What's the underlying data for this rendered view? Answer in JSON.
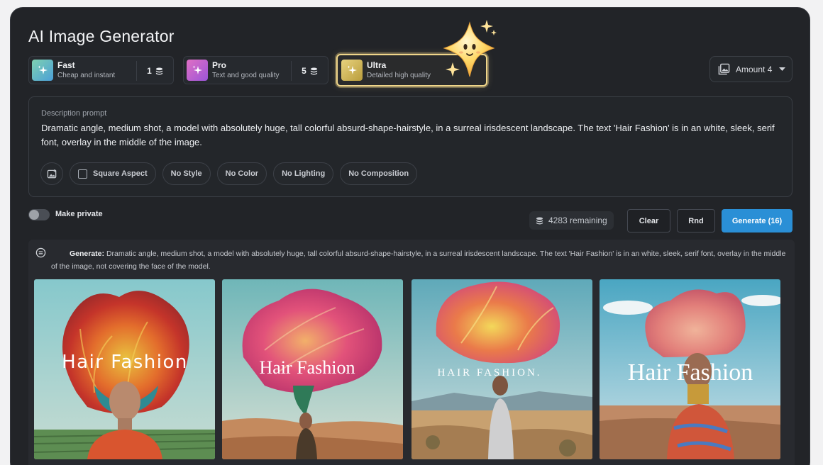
{
  "app": {
    "title": "AI Image Generator"
  },
  "tiers": [
    {
      "name": "Fast",
      "sub": "Cheap and instant",
      "cost": "1"
    },
    {
      "name": "Pro",
      "sub": "Text and good quality",
      "cost": "5"
    },
    {
      "name": "Ultra",
      "sub": "Detailed high quality",
      "selected": true
    }
  ],
  "amount": {
    "label": "Amount 4"
  },
  "prompt": {
    "label": "Description prompt",
    "text": "Dramatic angle, medium shot, a model with absolutely huge, tall colorful absurd-shape-hairstyle, in a surreal irisdescent landscape. The text 'Hair Fashion' is in an white, sleek, serif font, overlay in the middle of the image."
  },
  "chips": {
    "square": "Square Aspect",
    "style": "No Style",
    "color": "No Color",
    "lighting": "No Lighting",
    "composition": "No Composition"
  },
  "private": {
    "label": "Make private",
    "on": false
  },
  "credits": {
    "remaining": "4283 remaining"
  },
  "actions": {
    "clear": "Clear",
    "rnd": "Rnd",
    "generate": "Generate (16)"
  },
  "result": {
    "prefix": "Generate:",
    "text": "Dramatic angle, medium shot, a model with absolutely huge, tall colorful absurd-shape-hairstyle, in a surreal irisdescent landscape. The text 'Hair Fashion' is in an white, sleek, serif font, overlay in the middle of the image, not covering the face of the model."
  },
  "images": [
    {
      "caption": "Hair Fashion"
    },
    {
      "caption": "Hair Fashion"
    },
    {
      "caption": "HAIR  FASHION."
    },
    {
      "caption": "Hair  Fashion"
    }
  ],
  "colors": {
    "accent": "#2a8fd6",
    "ultra_border": "#f0d68a",
    "panel": "#222428"
  }
}
